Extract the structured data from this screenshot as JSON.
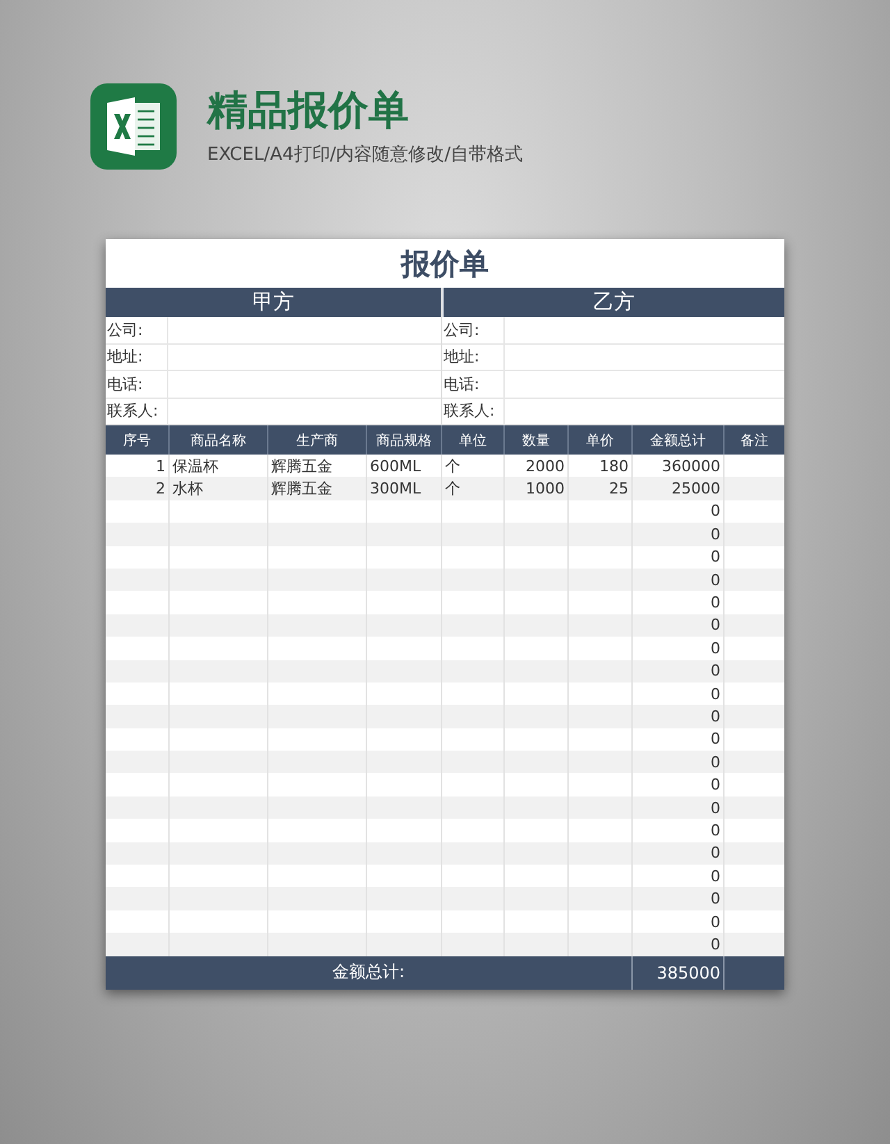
{
  "header": {
    "title": "精品报价单",
    "subtitle": "EXCEL/A4打印/内容随意修改/自带格式"
  },
  "sheet": {
    "title": "报价单",
    "parties": [
      {
        "name": "甲方",
        "fields": [
          "公司:",
          "地址:",
          "电话:",
          "联系人:"
        ]
      },
      {
        "name": "乙方",
        "fields": [
          "公司:",
          "地址:",
          "电话:",
          "联系人:"
        ]
      }
    ],
    "columns": [
      "序号",
      "商品名称",
      "生产商",
      "商品规格",
      "单位",
      "数量",
      "单价",
      "金额总计",
      "备注"
    ],
    "rows": [
      {
        "index": "1",
        "name": "保温杯",
        "maker": "辉腾五金",
        "spec": "600ML",
        "unit": "个",
        "qty": "2000",
        "price": "180",
        "amount": "360000"
      },
      {
        "index": "2",
        "name": "水杯",
        "maker": "辉腾五金",
        "spec": "300ML",
        "unit": "个",
        "qty": "1000",
        "price": "25",
        "amount": "25000"
      },
      {
        "amount": "0"
      },
      {
        "amount": "0"
      },
      {
        "amount": "0"
      },
      {
        "amount": "0"
      },
      {
        "amount": "0"
      },
      {
        "amount": "0"
      },
      {
        "amount": "0"
      },
      {
        "amount": "0"
      },
      {
        "amount": "0"
      },
      {
        "amount": "0"
      },
      {
        "amount": "0"
      },
      {
        "amount": "0"
      },
      {
        "amount": "0"
      },
      {
        "amount": "0"
      },
      {
        "amount": "0"
      },
      {
        "amount": "0"
      },
      {
        "amount": "0"
      },
      {
        "amount": "0"
      },
      {
        "amount": "0"
      },
      {
        "amount": "0"
      }
    ],
    "total_label": "金额总计:",
    "total_value": "385000"
  }
}
